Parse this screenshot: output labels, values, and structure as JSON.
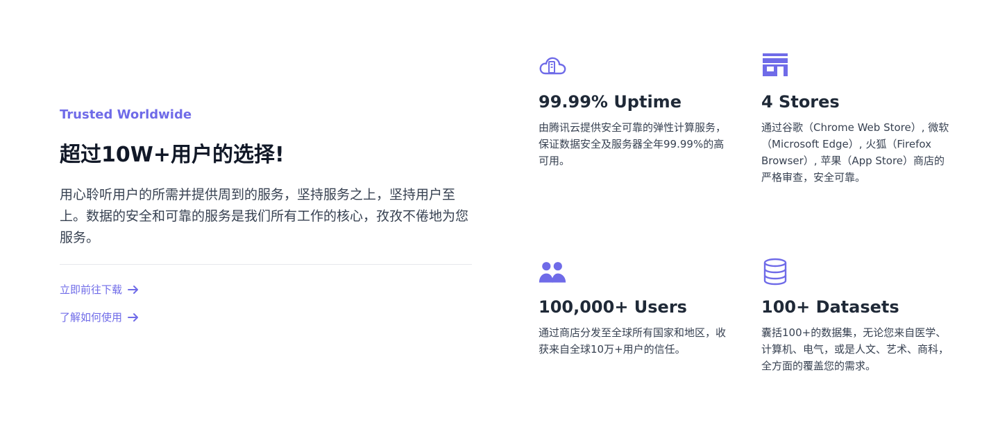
{
  "intro": {
    "eyebrow": "Trusted Worldwide",
    "title": "超过10W+用户的选择!",
    "description": "用心聆听用户的所需并提供周到的服务，坚持服务之上，坚持用户至上。数据的安全和可靠的服务是我们所有工作的核心，孜孜不倦地为您服务。",
    "links": [
      {
        "label": "立即前往下载"
      },
      {
        "label": "了解如何使用"
      }
    ]
  },
  "features": [
    {
      "icon": "cloud-server-icon",
      "title": "99.99% Uptime",
      "description": "由腾讯云提供安全可靠的弹性计算服务，保证数据安全及服务器全年99.99%的高可用。"
    },
    {
      "icon": "store-icon",
      "title": "4 Stores",
      "description": "通过谷歌（Chrome Web Store）, 微软（Microsoft Edge）, 火狐（Firefox Browser）, 苹果（App Store）商店的严格审查，安全可靠。"
    },
    {
      "icon": "users-icon",
      "title": "100,000+ Users",
      "description": "通过商店分发至全球所有国家和地区，收获来自全球10万+用户的信任。"
    },
    {
      "icon": "database-icon",
      "title": "100+ Datasets",
      "description": "囊括100+的数据集，无论您来自医学、计算机、电气，或是人文、艺术、商科，全方面的覆盖您的需求。"
    }
  ],
  "colors": {
    "accent": "#6f6be8",
    "heading": "#111827",
    "body": "#374151",
    "divider": "#e5e7eb"
  }
}
